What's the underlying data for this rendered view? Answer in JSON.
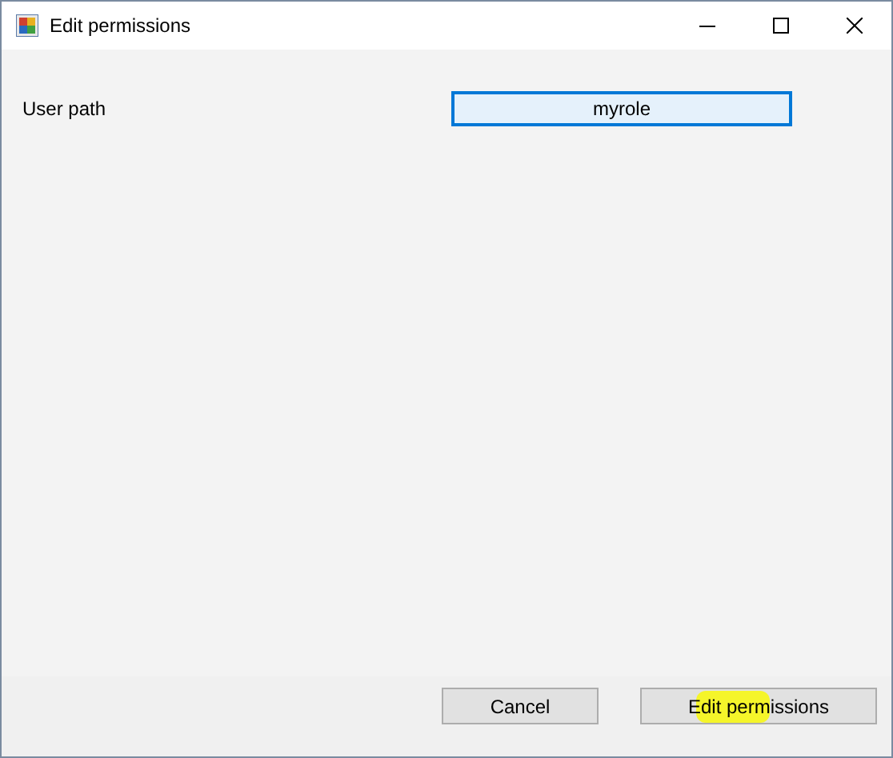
{
  "window": {
    "title": "Edit permissions"
  },
  "fields": [
    {
      "label": "User path",
      "value": "myrole",
      "focused": true
    }
  ],
  "buttons": [
    {
      "label": "Cancel"
    },
    {
      "label": "Edit permissions"
    }
  ]
}
